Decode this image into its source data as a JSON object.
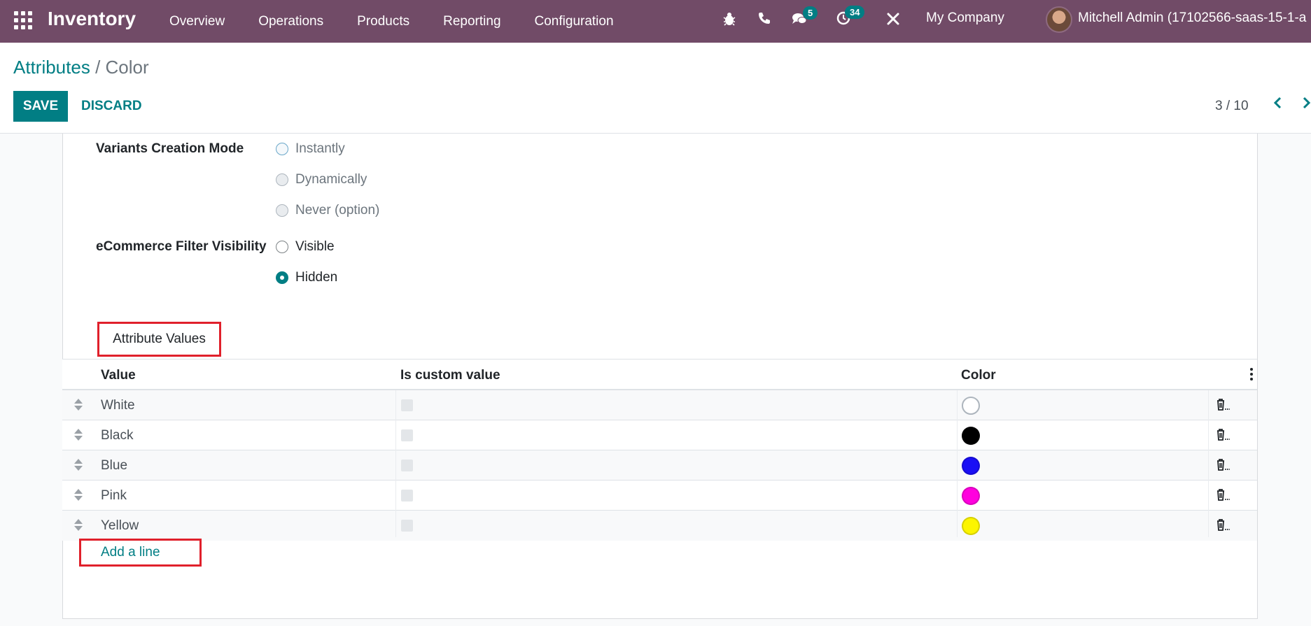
{
  "navbar": {
    "app_name": "Inventory",
    "menu": [
      "Overview",
      "Operations",
      "Products",
      "Reporting",
      "Configuration"
    ],
    "messages_count": "5",
    "activities_count": "34",
    "company": "My Company",
    "user": "Mitchell Admin (17102566-saas-15-1-a"
  },
  "breadcrumb": {
    "parent": "Attributes",
    "separator": "/",
    "current": "Color"
  },
  "actions": {
    "save": "SAVE",
    "discard": "DISCARD"
  },
  "pager": {
    "value": "3 / 10"
  },
  "form": {
    "variants_label": "Variants Creation Mode",
    "variants_options": [
      "Instantly",
      "Dynamically",
      "Never (option)"
    ],
    "ecommerce_label": "eCommerce Filter Visibility",
    "ecommerce_options": [
      "Visible",
      "Hidden"
    ],
    "ecommerce_selected": "Hidden"
  },
  "tab": {
    "label": "Attribute Values"
  },
  "table": {
    "columns": [
      "Value",
      "Is custom value",
      "Color"
    ],
    "rows": [
      {
        "value": "White",
        "color": "#ffffff"
      },
      {
        "value": "Black",
        "color": "#000000"
      },
      {
        "value": "Blue",
        "color": "#1a0ff5"
      },
      {
        "value": "Pink",
        "color": "#ff00de"
      },
      {
        "value": "Yellow",
        "color": "#fcf500"
      }
    ],
    "add_line": "Add a line"
  },
  "colors": {
    "brand": "#714b67",
    "accent": "#017e84",
    "highlight": "#e0202b"
  },
  "icons": [
    "apps-icon",
    "bug-icon",
    "phone-icon",
    "chat-icon",
    "clock-icon",
    "tools-icon",
    "chevron-left-icon",
    "chevron-right-icon",
    "trash-icon",
    "drag-handle-icon",
    "kebab-icon"
  ]
}
